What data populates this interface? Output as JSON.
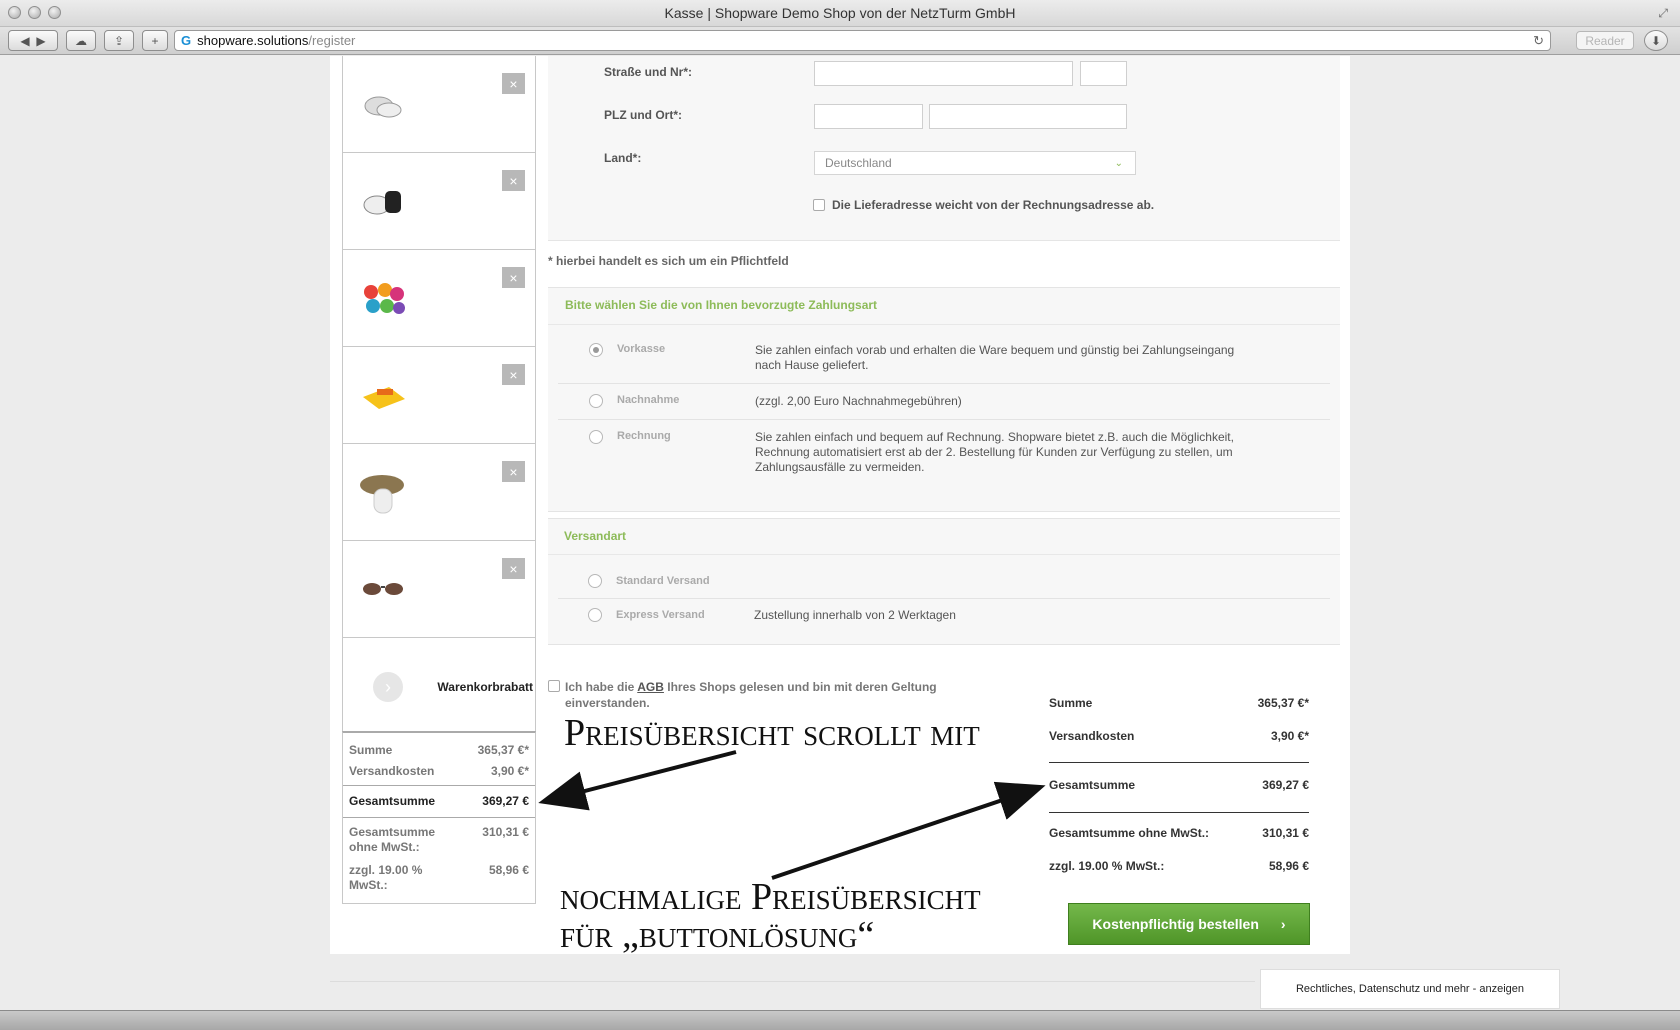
{
  "window": {
    "title": "Kasse | Shopware Demo Shop von der NetzTurm GmbH"
  },
  "browser": {
    "url_host": "shopware.solutions",
    "url_path": "/register",
    "reader_label": "Reader"
  },
  "form": {
    "street_label": "Straße und Nr*:",
    "zip_label": "PLZ und Ort*:",
    "country_label": "Land*:",
    "country_value": "Deutschland",
    "alt_address_label": "Die Lieferadresse weicht von der Rechnungsadresse ab.",
    "required_note": "* hierbei handelt es sich um ein Pflichtfeld"
  },
  "payment": {
    "heading": "Bitte wählen Sie die von Ihnen bevorzugte Zahlungsart",
    "options": [
      {
        "name": "Vorkasse",
        "desc": "Sie zahlen einfach vorab und erhalten die Ware bequem und günstig bei Zahlungseingang nach Hause geliefert.",
        "selected": true
      },
      {
        "name": "Nachnahme",
        "desc": "(zzgl. 2,00 Euro Nachnahmegebühren)",
        "selected": false
      },
      {
        "name": "Rechnung",
        "desc": "Sie zahlen einfach und bequem auf Rechnung. Shopware bietet z.B. auch die Möglichkeit, Rechnung automatisiert erst ab der 2. Bestellung für Kunden zur Verfügung zu stellen, um Zahlungsausfälle zu vermeiden.",
        "selected": false
      }
    ]
  },
  "shipping": {
    "heading": "Versandart",
    "options": [
      {
        "name": "Standard Versand",
        "desc": ""
      },
      {
        "name": "Express Versand",
        "desc": "Zustellung innerhalb von 2 Werktagen"
      }
    ]
  },
  "agb": {
    "text_before": "Ich habe die",
    "link": "AGB",
    "text_after": "Ihres Shops gelesen und bin mit deren Geltung einverstanden."
  },
  "sidebar": {
    "items": [
      {
        "icon": "gloves-white-icon"
      },
      {
        "icon": "gloves-black-icon"
      },
      {
        "icon": "colorful-rolls-icon"
      },
      {
        "icon": "yellow-towel-icon"
      },
      {
        "icon": "flat-cap-icon"
      },
      {
        "icon": "sunglasses-icon"
      }
    ],
    "discount_label": "Warenkorbrabatt",
    "remove_symbol": "×",
    "summe_label": "Summe",
    "summe_value": "365,37 €*",
    "versand_label": "Versandkosten",
    "versand_value": "3,90 €*",
    "gesamt_label": "Gesamtsumme",
    "gesamt_value": "369,27 €",
    "netto_label": "Gesamtsumme ohne MwSt.:",
    "netto_value": "310,31 €",
    "mwst_label": "zzgl. 19.00 % MwSt.:",
    "mwst_value": "58,96 €"
  },
  "summary": {
    "summe_label": "Summe",
    "summe_value": "365,37 €*",
    "versand_label": "Versandkosten",
    "versand_value": "3,90 €*",
    "gesamt_label": "Gesamtsumme",
    "gesamt_value": "369,27 €",
    "netto_label": "Gesamtsumme ohne MwSt.:",
    "netto_value": "310,31 €",
    "mwst_label": "zzgl. 19.00 % MwSt.:",
    "mwst_value": "58,96 €"
  },
  "cta": {
    "label": "Kostenpflichtig bestellen",
    "arrow": "›"
  },
  "annotations": {
    "top": "Preisübersicht scrollt mit",
    "bottom_line1": "nochmalige Preisübersicht",
    "bottom_line2": "für „buttonlösung“"
  },
  "footer": {
    "legal_label": "Rechtliches, Datenschutz und mehr - anzeigen"
  }
}
